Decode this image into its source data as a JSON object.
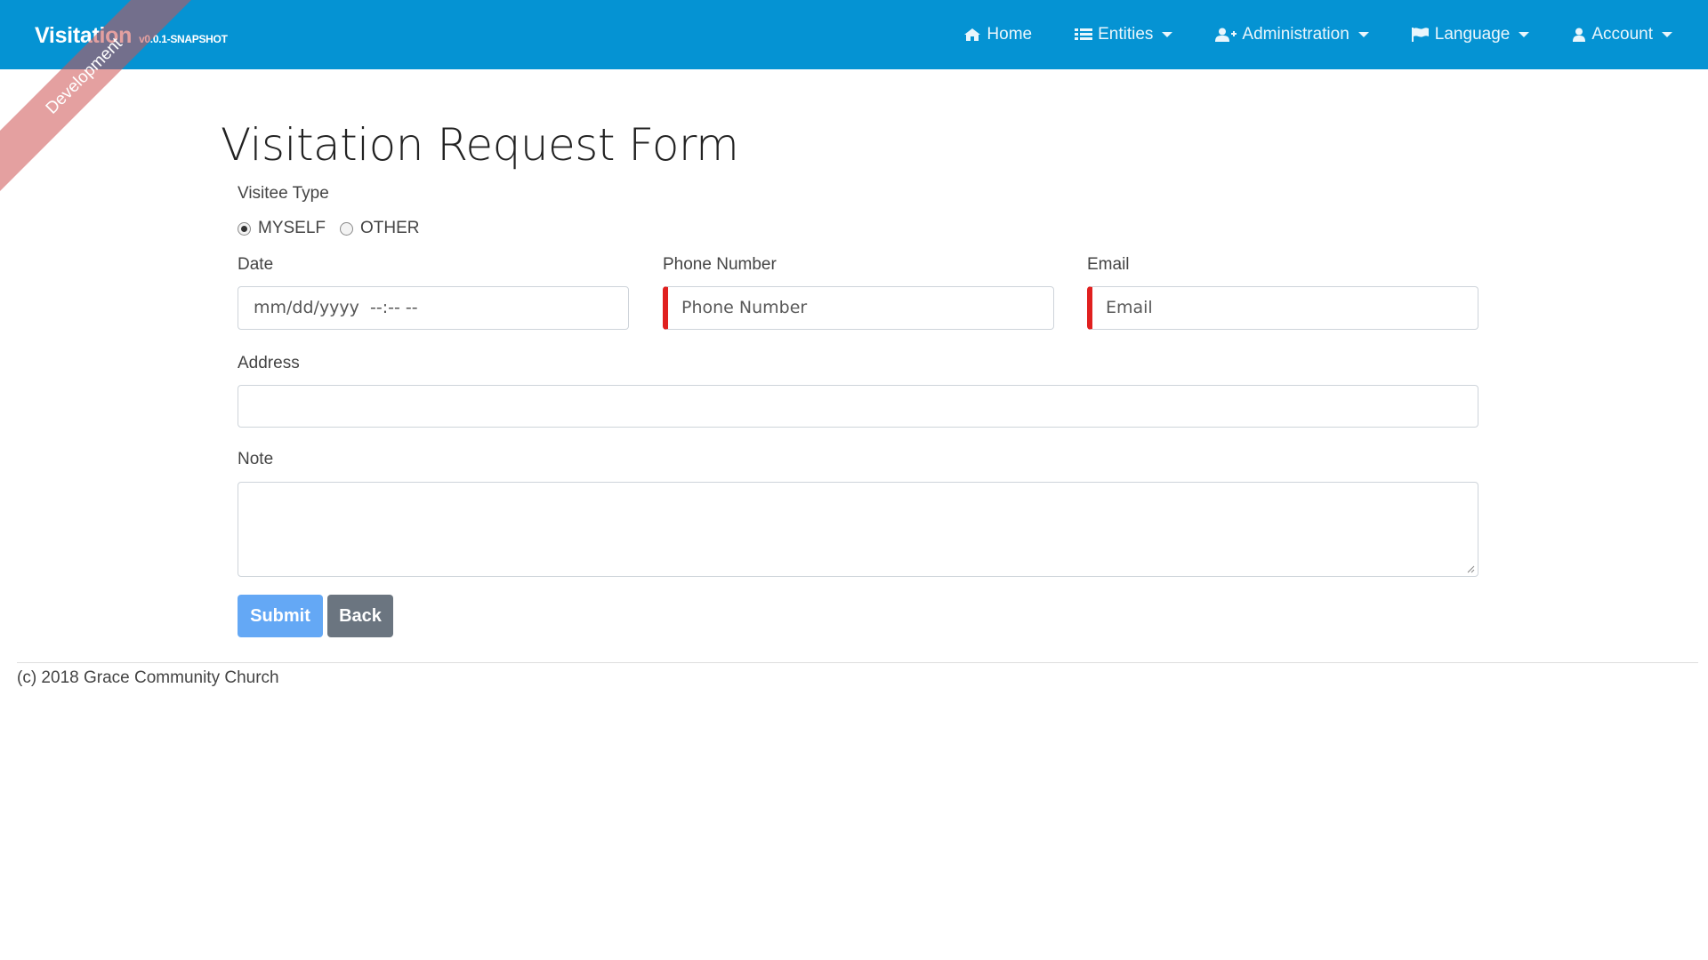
{
  "navbar": {
    "brand_title": "Visitation",
    "brand_version": "v0.0.1-SNAPSHOT",
    "ribbon": "Development",
    "color": "#0593d3",
    "items": [
      {
        "label": "Home",
        "icon": "home-icon",
        "dropdown": false
      },
      {
        "label": "Entities",
        "icon": "list-icon",
        "dropdown": true
      },
      {
        "label": "Administration",
        "icon": "user-plus-icon",
        "dropdown": true
      },
      {
        "label": "Language",
        "icon": "flag-icon",
        "dropdown": true
      },
      {
        "label": "Account",
        "icon": "user-icon",
        "dropdown": true
      }
    ]
  },
  "form": {
    "title": "Visitation Request Form",
    "visitee_type_label": "Visitee Type",
    "visitee_options": [
      {
        "label": "MYSELF",
        "checked": true
      },
      {
        "label": "OTHER",
        "checked": false
      }
    ],
    "date_label": "Date",
    "date_value": "mm/dd/yyyy  --:-- --",
    "phone_label": "Phone Number",
    "phone_placeholder": "Phone Number",
    "email_label": "Email",
    "email_placeholder": "Email",
    "address_label": "Address",
    "address_value": "",
    "note_label": "Note",
    "note_value": "",
    "submit_label": "Submit",
    "back_label": "Back",
    "invalid_color": "#e0201f"
  },
  "footer": {
    "text": "(c) 2018 Grace Community Church"
  }
}
